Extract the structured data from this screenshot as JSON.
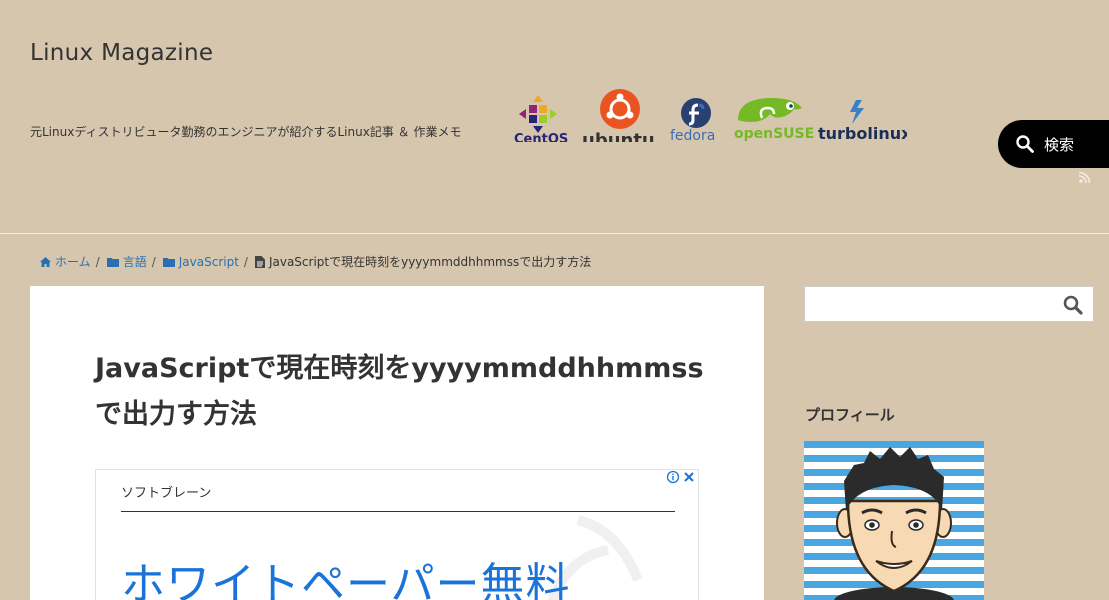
{
  "site": {
    "title": "Linux Magazine",
    "description": "元Linuxディストリビュータ勤務のエンジニアが紹介するLinux記事 ＆ 作業メモ"
  },
  "logos": [
    {
      "icon": "centos-logo",
      "label": "CentOS"
    },
    {
      "icon": "ubuntu-logo",
      "label": "ubuntu"
    },
    {
      "icon": "fedora-logo",
      "label": "fedora"
    },
    {
      "icon": "opensuse-logo",
      "label": "openSUSE"
    },
    {
      "icon": "turbolinux-logo",
      "label": "turbolinux"
    }
  ],
  "header": {
    "search_label": "検索"
  },
  "breadcrumb": {
    "home": "ホーム",
    "category": "言語",
    "subcategory": "JavaScript",
    "current": "JavaScriptで現在時刻をyyyymmddhhmmssで出力す方法"
  },
  "article": {
    "title": "JavaScriptで現在時刻をyyyymmddhhmmssで出力す方法"
  },
  "ad": {
    "advertiser": "ソフトブレーン",
    "headline": "ホワイトペーパー無料"
  },
  "sidebar": {
    "search_placeholder": "",
    "profile_heading": "プロフィール"
  },
  "colors": {
    "background": "#d7c6ae",
    "link": "#2a6fb0",
    "ad_headline": "#1a73d9",
    "search_button": "#000000"
  }
}
